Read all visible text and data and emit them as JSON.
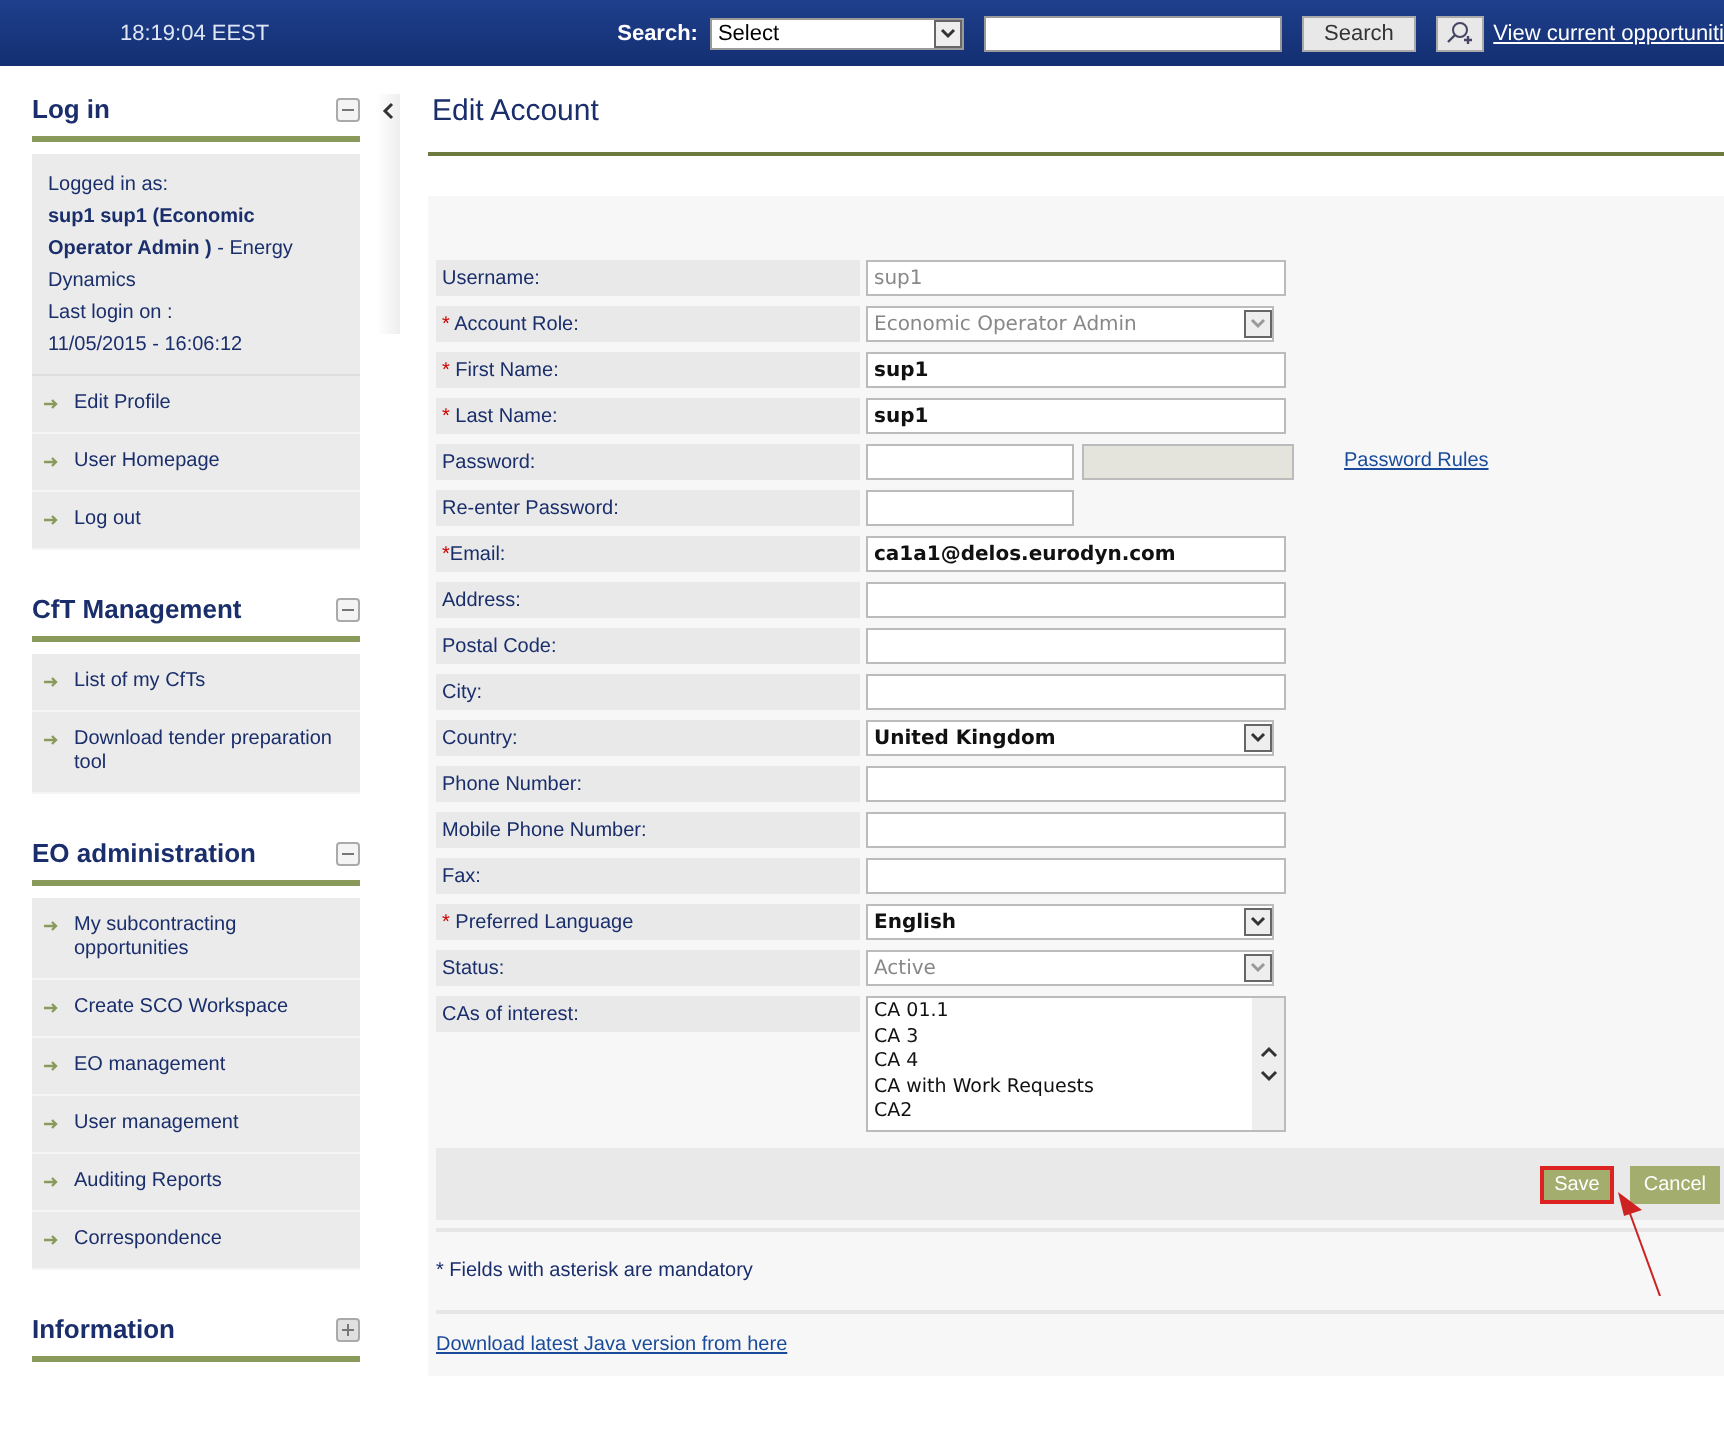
{
  "top_bar": {
    "time": "18:19:04 EEST",
    "search_label": "Search:",
    "search_select": "Select",
    "search_button": "Search",
    "opportunities_link": "View current opportuniti"
  },
  "sidebar": [
    {
      "title": "Log in",
      "expanded": true,
      "info": [
        "Logged in as:",
        "**sup1 sup1 (Economic Operator Admin )** - Energy Dynamics",
        "Last login on :",
        "11/05/2015 - 16:06:12"
      ],
      "items": [
        "Edit Profile",
        "User Homepage",
        "Log out"
      ]
    },
    {
      "title": "CfT Management",
      "expanded": true,
      "items": [
        "List of my CfTs",
        "Download tender preparation tool"
      ]
    },
    {
      "title": "EO administration",
      "expanded": true,
      "items": [
        "My subcontracting opportunities",
        "Create SCO Workspace",
        "EO management",
        "User management",
        "Auditing Reports",
        "Correspondence"
      ]
    },
    {
      "title": "Information",
      "expanded": false
    }
  ],
  "page_title": "Edit Account",
  "fields": [
    {
      "label": "Username:",
      "required": false,
      "kind": "text",
      "value": "sup1",
      "disabled": true
    },
    {
      "label": "* Account Role:",
      "required": true,
      "kind": "select",
      "value": "Economic Operator Admin",
      "disabled": true
    },
    {
      "label": "* First Name:",
      "required": true,
      "kind": "text",
      "value": "sup1",
      "disabled": false
    },
    {
      "label": "* Last Name:",
      "required": true,
      "kind": "text",
      "value": "sup1",
      "disabled": false
    },
    {
      "label": "Password:",
      "required": false,
      "kind": "password",
      "link": "Password Rules"
    },
    {
      "label": "Re-enter Password:",
      "required": false,
      "kind": "short"
    },
    {
      "label": "*Email:",
      "required": true,
      "kind": "text",
      "value": "ca1a1@delos.eurodyn.com",
      "disabled": false
    },
    {
      "label": "Address:",
      "required": false,
      "kind": "text"
    },
    {
      "label": "Postal Code:",
      "required": false,
      "kind": "text"
    },
    {
      "label": "City:",
      "required": false,
      "kind": "text"
    },
    {
      "label": "Country:",
      "required": false,
      "kind": "select",
      "value": "United Kingdom",
      "disabled": false
    },
    {
      "label": "Phone Number:",
      "required": false,
      "kind": "text"
    },
    {
      "label": "Mobile Phone Number:",
      "required": false,
      "kind": "text"
    },
    {
      "label": "Fax:",
      "required": false,
      "kind": "text"
    },
    {
      "label": "* Preferred Language",
      "required": true,
      "kind": "select",
      "value": "English",
      "disabled": false
    },
    {
      "label": "Status:",
      "required": false,
      "kind": "select",
      "value": "Active",
      "disabled": true
    },
    {
      "label": "CAs of interest:",
      "required": false,
      "kind": "list",
      "options": [
        "CA 01.1",
        "CA 3",
        "CA 4",
        "CA with Work Requests",
        "CA2"
      ]
    }
  ],
  "buttons": [
    {
      "label": "Save",
      "highlighted": true
    },
    {
      "label": "Cancel",
      "highlighted": false
    }
  ],
  "mandatory_note": "* Fields with asterisk are mandatory",
  "java_link": "Download latest Java version from here"
}
